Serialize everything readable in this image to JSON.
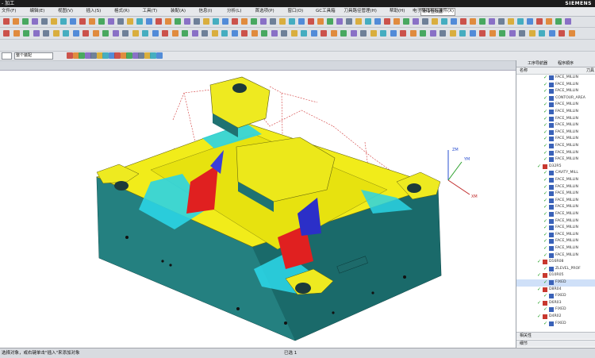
{
  "window": {
    "title": "- 加工",
    "brand": "SIEMENS"
  },
  "menu": {
    "items": [
      "文件(F)",
      "编辑(E)",
      "视图(V)",
      "插入(S)",
      "格式(R)",
      "工具(T)",
      "装配(A)",
      "信息(I)",
      "分析(L)",
      "首选项(P)",
      "窗口(O)",
      "GC工具箱",
      "刀具路径管理(H)",
      "帮助(H)",
      "电子棒线机标准件(X)"
    ],
    "command_finder_placeholder": "命令查找器"
  },
  "toolbar": {
    "filter_combo": "整个装配",
    "selection_combo": "无选择过滤器"
  },
  "navigator": {
    "tabs": [
      "工序导航器",
      "程序顺序"
    ],
    "columns": [
      "名称",
      "刀具"
    ],
    "rows": [
      {
        "label": "FACE_MILLIN",
        "indent": 2,
        "status": "ok"
      },
      {
        "label": "FACE_MILLIN",
        "indent": 2,
        "status": "ok"
      },
      {
        "label": "FACE_MILLIN",
        "indent": 2,
        "status": "ok"
      },
      {
        "label": "CONTOUR_AREA",
        "indent": 2,
        "status": "ok"
      },
      {
        "label": "FACE_MILLIN",
        "indent": 2,
        "status": "ok"
      },
      {
        "label": "FACE_MILLIN",
        "indent": 2,
        "status": "ok"
      },
      {
        "label": "FACE_MILLIN",
        "indent": 2,
        "status": "ok"
      },
      {
        "label": "FACE_MILLIN",
        "indent": 2,
        "status": "ok"
      },
      {
        "label": "FACE_MILLIN",
        "indent": 2,
        "status": "ok"
      },
      {
        "label": "FACE_MILLIN",
        "indent": 2,
        "status": "ok"
      },
      {
        "label": "FACE_MILLIN",
        "indent": 2,
        "status": "ok"
      },
      {
        "label": "FACE_MILLIN",
        "indent": 2,
        "status": "ok"
      },
      {
        "label": "FACE_MILLIN",
        "indent": 2,
        "status": "ok"
      },
      {
        "label": "D32R5",
        "indent": 1,
        "status": "group"
      },
      {
        "label": "CAVITY_MILL",
        "indent": 2,
        "status": "ok"
      },
      {
        "label": "FACE_MILLIN",
        "indent": 2,
        "status": "ok"
      },
      {
        "label": "FACE_MILLIN",
        "indent": 2,
        "status": "ok"
      },
      {
        "label": "FACE_MILLIN",
        "indent": 2,
        "status": "ok"
      },
      {
        "label": "FACE_MILLIN",
        "indent": 2,
        "status": "ok"
      },
      {
        "label": "FACE_MILLIN",
        "indent": 2,
        "status": "ok"
      },
      {
        "label": "FACE_MILLIN",
        "indent": 2,
        "status": "ok"
      },
      {
        "label": "FACE_MILLIN",
        "indent": 2,
        "status": "ok"
      },
      {
        "label": "FACE_MILLIN",
        "indent": 2,
        "status": "ok"
      },
      {
        "label": "FACE_MILLIN",
        "indent": 2,
        "status": "ok"
      },
      {
        "label": "FACE_MILLIN",
        "indent": 2,
        "status": "ok"
      },
      {
        "label": "FACE_MILLIN",
        "indent": 2,
        "status": "ok"
      },
      {
        "label": "FACE_MILLIN",
        "indent": 2,
        "status": "ok"
      },
      {
        "label": "D16R08",
        "indent": 1,
        "status": "group"
      },
      {
        "label": "ZLEVEL_PROF",
        "indent": 2,
        "status": "ok"
      },
      {
        "label": "D10R05",
        "indent": 1,
        "status": "group"
      },
      {
        "label": "FIXED",
        "indent": 2,
        "status": "selected"
      },
      {
        "label": "D8R04",
        "indent": 1,
        "status": "group"
      },
      {
        "label": "FIXED",
        "indent": 2,
        "status": "ok"
      },
      {
        "label": "D6R03",
        "indent": 1,
        "status": "group"
      },
      {
        "label": "FIXED",
        "indent": 2,
        "status": "ok"
      },
      {
        "label": "D4R02",
        "indent": 1,
        "status": "group"
      },
      {
        "label": "FIXED",
        "indent": 2,
        "status": "ok"
      }
    ],
    "bottom_sections": [
      "相关性",
      "细节"
    ]
  },
  "viewport": {
    "triad": {
      "x": "XM",
      "y": "YM",
      "z": "ZM"
    }
  },
  "status": {
    "message": "选择对象，或右键单击\"插入\"来添加对象",
    "selection": "已选 1"
  }
}
